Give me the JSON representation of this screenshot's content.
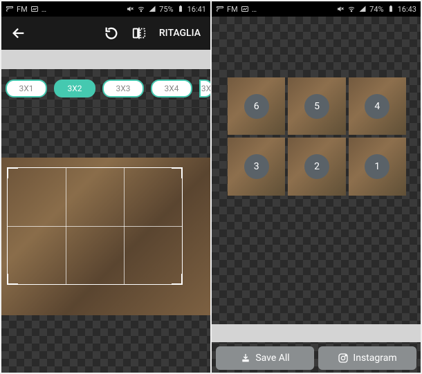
{
  "left_screen": {
    "status": {
      "fm_label": "FM",
      "battery": "75%",
      "time": "16:41"
    },
    "toolbar": {
      "back_name": "back-icon",
      "rotate_name": "rotate-icon",
      "flip_name": "flip-icon",
      "crop_label": "RITAGLIA"
    },
    "options": [
      "3X1",
      "3X2",
      "3X3",
      "3X4",
      "3X"
    ],
    "active_option": 1
  },
  "right_screen": {
    "status": {
      "fm_label": "FM",
      "battery": "74%",
      "time": "16:43"
    },
    "tiles": [
      6,
      5,
      4,
      3,
      2,
      1
    ],
    "actions": {
      "save_label": "Save All",
      "instagram_label": "Instagram"
    }
  }
}
